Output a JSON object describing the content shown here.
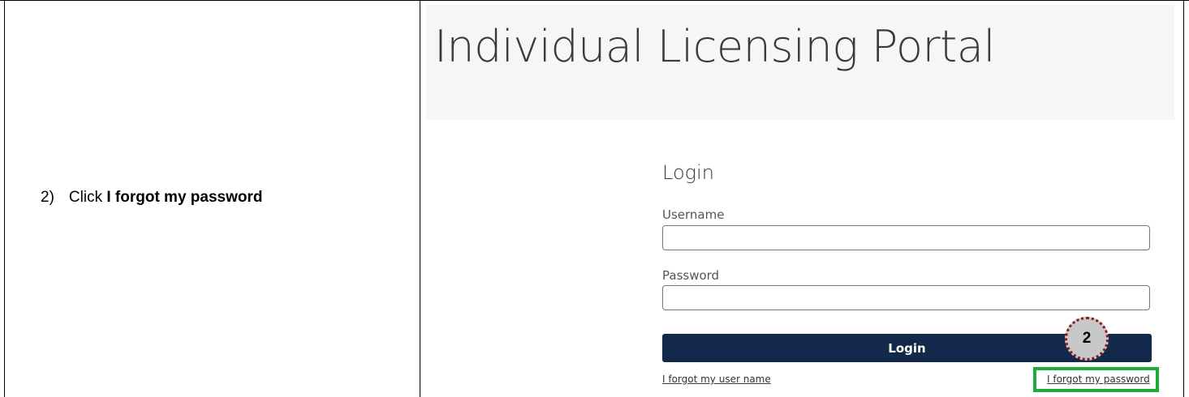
{
  "instruction": {
    "step_number": "2)",
    "prefix": "Click ",
    "emphasis": "I forgot my password"
  },
  "portal": {
    "title": "Individual Licensing Portal"
  },
  "login": {
    "heading": "Login",
    "username_label": "Username",
    "username_value": "",
    "password_label": "Password",
    "password_value": "",
    "button_label": "Login",
    "forgot_username_link": "I forgot my user name",
    "forgot_password_link": "I forgot my password"
  },
  "annotation": {
    "step_marker": "2",
    "highlight_color": "#1faa3a",
    "marker_border_color": "#8b1a1a"
  },
  "colors": {
    "button_bg": "#13294b",
    "header_bg": "#f6f6f6"
  }
}
